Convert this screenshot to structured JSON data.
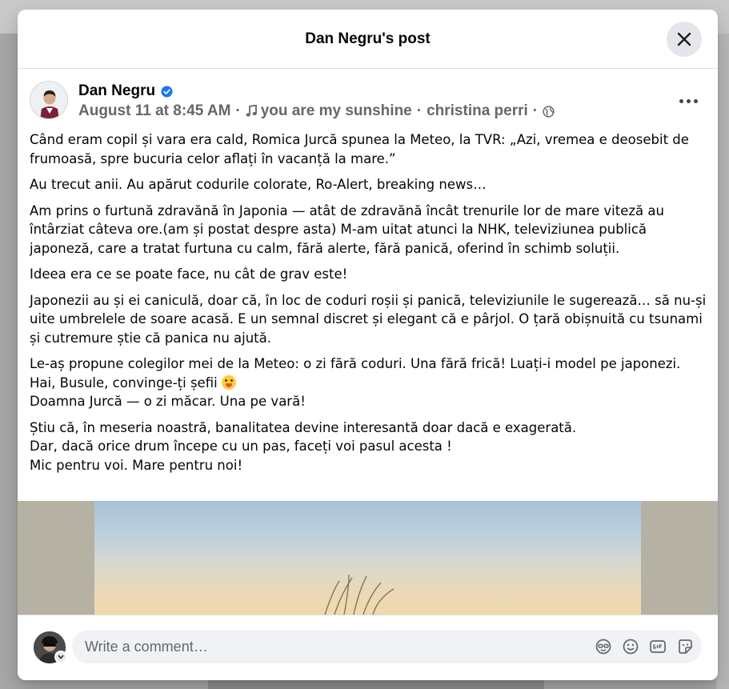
{
  "modal": {
    "title": "Dan Negru's post"
  },
  "post": {
    "author": "Dan Negru",
    "date": "August 11 at 8:45 AM",
    "music": "you are my sunshine",
    "artist": "christina perri",
    "separator": "·",
    "paragraphs": [
      "Când eram copil și vara era cald, Romica Jurcă spunea la Meteo, la TVR: „Azi, vremea e deosebit de frumoasă, spre bucuria celor aflați în vacanță la mare.”",
      "Au trecut anii. Au apărut codurile colorate, Ro-Alert, breaking news…",
      "Am prins o furtună zdravănă în Japonia — atât de zdravănă încât trenurile lor de mare viteză au întârziat câteva ore.(am și postat despre asta) M-am uitat atunci la NHK, televiziunea publică japoneză, care a tratat furtuna cu calm, fără alerte, fără panică, oferind în schimb soluții.",
      "Ideea era ce se poate face, nu cât de grav este!",
      "Japonezii au și ei caniculă, doar că, în loc de coduri roșii și panică, televiziunile le sugerează… să nu-și uite umbrelele de soare acasă. E un semnal discret și elegant că e pârjol. O țară obișnuită cu tsunami și cutremure știe că panica nu ajută."
    ],
    "p6_line1": "Le-aș propune colegilor mei de la Meteo: o zi fără coduri. Una fără frică! Luați-i model pe japonezi. Hai, Busule, convinge-ți șefii",
    "p6_line2": "Doamna Jurcă — o zi măcar. Una pe vară!",
    "p7_line1": "Știu că, în meseria noastră, banalitatea devine interesantă doar dacă e exagerată.",
    "p7_line2": "Dar, dacă orice drum începe cu un pas, faceți voi pasul acesta !",
    "p7_line3": "Mic pentru voi. Mare pentru noi!"
  },
  "icons": {
    "close": "close-icon",
    "verified": "verified-badge-icon",
    "music": "music-note-icon",
    "privacy": "globe-icon",
    "more": "more-options-icon",
    "emoji_in_text": "zany-face-emoji",
    "avatar_chooser": "avatar-chooser-icon",
    "comment_avatar_sticker": "avatar-sticker-icon",
    "comment_emoji": "emoji-icon",
    "comment_gif": "gif-icon",
    "comment_sticker": "sticker-icon"
  },
  "comment": {
    "placeholder": "Write a comment…"
  },
  "colors": {
    "verified_blue": "#1877f2",
    "secondary_text": "#65676b",
    "primary_text": "#050505",
    "input_bg": "#f0f2f5"
  }
}
